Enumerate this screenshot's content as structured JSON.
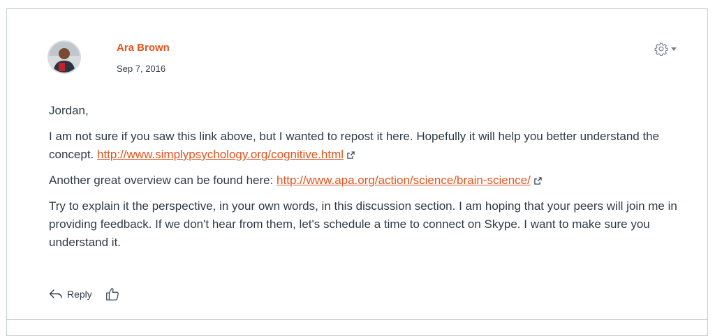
{
  "post": {
    "author_name": "Ara Brown",
    "date": "Sep 7, 2016",
    "settings_icon": "gear-icon",
    "accent_color": "#e4541d",
    "greeting": "Jordan,",
    "paragraph1_text": "I am not sure if you saw this link above, but I wanted to repost it here. Hopefully it will help you better understand the concept. ",
    "link1": "http://www.simplypsychology.org/cognitive.html",
    "paragraph2_text": "Another great overview can be found here: ",
    "link2": "http://www.apa.org/action/science/brain-science/",
    "paragraph3": "Try to explain it the perspective, in your own words, in this discussion section. I am hoping that your peers will join me in providing feedback. If we don't hear from them, let's schedule a time to connect on Skype. I want to make sure you understand it.",
    "reply_label": "Reply",
    "reply_icon": "reply-arrow-icon",
    "like_icon": "thumbs-up-icon",
    "external_link_icon": "external-link-icon"
  }
}
